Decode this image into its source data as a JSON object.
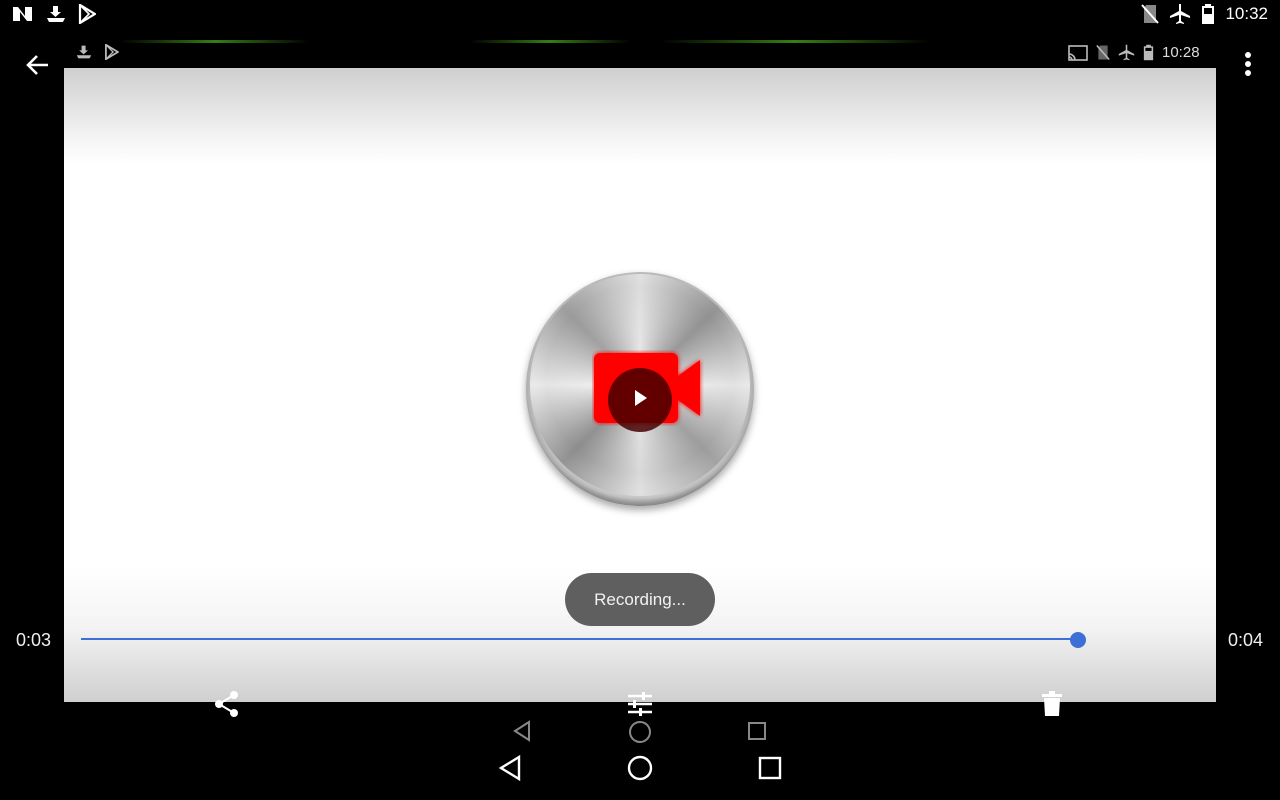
{
  "status_bar": {
    "time": "10:32",
    "left_icons": [
      "n-logo-icon",
      "download-icon",
      "play-store-icon"
    ],
    "right_icons": [
      "no-sim-icon",
      "airplane-mode-icon",
      "battery-icon"
    ]
  },
  "inner_status_bar": {
    "time": "10:28",
    "left_icons": [
      "download-icon",
      "play-store-icon"
    ],
    "right_icons": [
      "cast-icon",
      "no-sim-icon",
      "airplane-mode-icon",
      "battery-icon"
    ]
  },
  "toolbar": {
    "back_icon": "arrow-back-icon",
    "menu_icon": "more-vert-icon"
  },
  "player": {
    "thumbnail_icon": "video-camera-icon",
    "play_icon": "play-icon",
    "toast": "Recording...",
    "current_time": "0:03",
    "duration": "0:04",
    "progress": 0.99,
    "accent_color": "#3e6fd8"
  },
  "actions": {
    "share_icon": "share-icon",
    "tune_icon": "tune-icon",
    "delete_icon": "delete-icon"
  },
  "navigation": {
    "back_icon": "nav-back-icon",
    "home_icon": "nav-home-icon",
    "recents_icon": "nav-recents-icon"
  }
}
